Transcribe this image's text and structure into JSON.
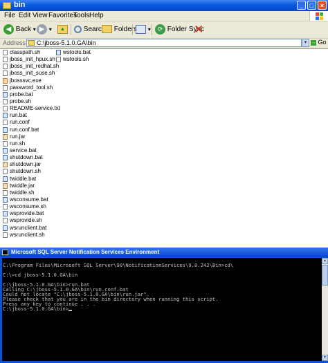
{
  "explorer": {
    "title": "bin",
    "window_buttons": {
      "minimize": "_",
      "maximize": "□",
      "close": "×"
    },
    "menu": [
      "File",
      "Edit",
      "View",
      "Favorites",
      "Tools",
      "Help"
    ],
    "toolbar": {
      "back_label": "Back",
      "back_dropdown": "▾",
      "forward_dropdown": "▾",
      "search_label": "Search",
      "folders_label": "Folders",
      "views_dropdown": "▾",
      "folder_sync_label": "Folder Sync"
    },
    "address": {
      "label": "Address",
      "value": "C:\\jboss-5.1.0.GA\\bin",
      "dropdown": "▾",
      "go_label": "Go",
      "go_arrow": "→"
    },
    "files_col1": [
      {
        "name": "classpath.sh",
        "type": "file"
      },
      {
        "name": "jboss_init_hpux.sh",
        "type": "file"
      },
      {
        "name": "jboss_init_redhat.sh",
        "type": "file"
      },
      {
        "name": "jboss_init_suse.sh",
        "type": "file"
      },
      {
        "name": "jbosssvc.exe",
        "type": "exe"
      },
      {
        "name": "password_tool.sh",
        "type": "file"
      },
      {
        "name": "probe.bat",
        "type": "bat"
      },
      {
        "name": "probe.sh",
        "type": "file"
      },
      {
        "name": "README-service.txt",
        "type": "file"
      },
      {
        "name": "run.bat",
        "type": "bat"
      },
      {
        "name": "run.conf",
        "type": "file"
      },
      {
        "name": "run.conf.bat",
        "type": "bat"
      },
      {
        "name": "run.jar",
        "type": "jar"
      },
      {
        "name": "run.sh",
        "type": "file"
      },
      {
        "name": "service.bat",
        "type": "bat"
      },
      {
        "name": "shutdown.bat",
        "type": "bat"
      },
      {
        "name": "shutdown.jar",
        "type": "jar"
      },
      {
        "name": "shutdown.sh",
        "type": "file"
      },
      {
        "name": "twiddle.bat",
        "type": "bat"
      },
      {
        "name": "twiddle.jar",
        "type": "jar"
      },
      {
        "name": "twiddle.sh",
        "type": "file"
      },
      {
        "name": "wsconsume.bat",
        "type": "bat"
      },
      {
        "name": "wsconsume.sh",
        "type": "file"
      },
      {
        "name": "wsprovide.bat",
        "type": "bat"
      },
      {
        "name": "wsprovide.sh",
        "type": "file"
      },
      {
        "name": "wsrunclient.bat",
        "type": "bat"
      },
      {
        "name": "wsrunclient.sh",
        "type": "file"
      }
    ],
    "files_col2": [
      {
        "name": "wstools.bat",
        "type": "bat"
      },
      {
        "name": "wstools.sh",
        "type": "file"
      }
    ]
  },
  "cmd": {
    "title": "Microsoft SQL Server Notification Services Environment",
    "lines": [
      "",
      "C:\\Program Files\\Microsoft SQL Server\\90\\NotificationServices\\9.0.242\\Bin>cd\\",
      "",
      "C:\\>cd jboss-5.1.0.GA\\bin",
      "",
      "C:\\jboss-5.1.0.GA\\bin>run.bat",
      "Calling C:\\jboss-5.1.0.GA\\bin\\run.conf.bat",
      "Could not locate \"C:\\jboss-5.1.0.GA\\bin\\run.jar\".",
      "Please check that you are in the bin directory when running this script.",
      "Press any key to continue . . .",
      "C:\\jboss-5.1.0.GA\\bin>"
    ],
    "scroll_up": "▲",
    "scroll_down": "▼"
  },
  "colors": {
    "xp_title_blue": "#0a5ae0",
    "console_bg": "#000000",
    "console_text": "#c0c0c0",
    "toolbar_bg": "#ece9d8"
  }
}
